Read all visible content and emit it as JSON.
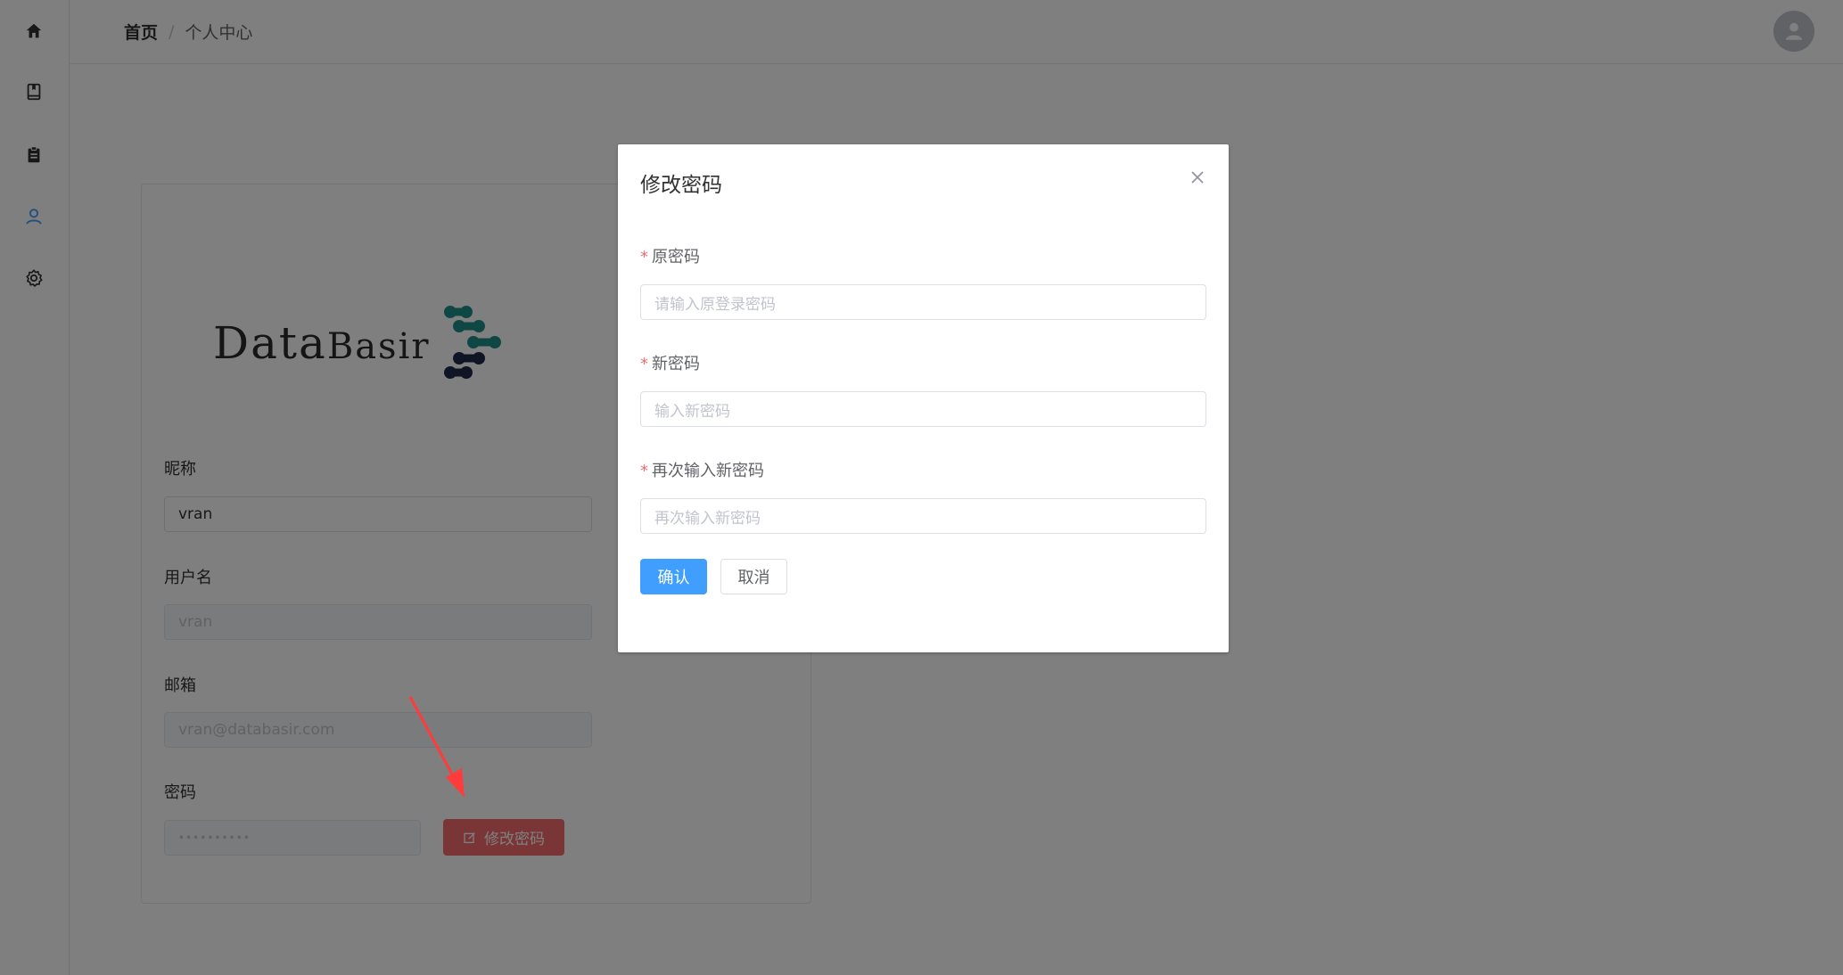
{
  "breadcrumb": {
    "home": "首页",
    "separator": "/",
    "current": "个人中心"
  },
  "logo": {
    "text_main": "Data",
    "text_small_caps": "Basir"
  },
  "profile": {
    "nickname_label": "昵称",
    "nickname_value": "vran",
    "username_label": "用户名",
    "username_value": "vran",
    "email_label": "邮箱",
    "email_value": "vran@databasir.com",
    "password_label": "密码",
    "password_value": "••••••••••",
    "change_password_button": "修改密码"
  },
  "dialog": {
    "title": "修改密码",
    "old_password_label": "原密码",
    "old_password_placeholder": "请输入原登录密码",
    "new_password_label": "新密码",
    "new_password_placeholder": "输入新密码",
    "confirm_password_label": "再次输入新密码",
    "confirm_password_placeholder": "再次输入新密码",
    "required_mark": "*",
    "confirm_button": "确认",
    "cancel_button": "取消"
  },
  "colors": {
    "primary": "#409eff",
    "danger": "#f56c6c",
    "sidebar_active": "#409eff",
    "logo_teal": "#1f8f8a",
    "logo_navy": "#1e2a4a",
    "arrow": "#ff3b3b"
  },
  "icons": {
    "sidebar": [
      "home-icon",
      "book-icon",
      "clipboard-icon",
      "user-icon",
      "settings-icon"
    ],
    "close": "close-icon",
    "edit": "edit-icon",
    "avatar": "user-avatar-icon"
  }
}
